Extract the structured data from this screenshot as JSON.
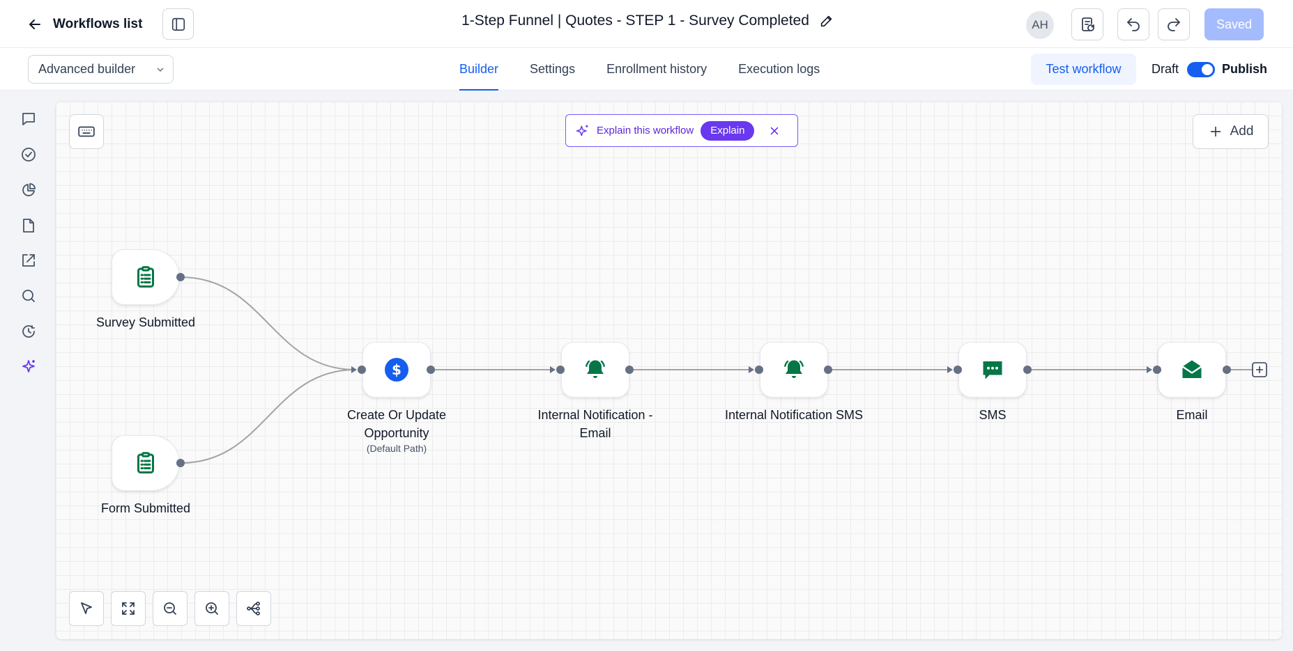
{
  "header": {
    "back_label": "Workflows list",
    "title": "1-Step Funnel | Quotes - STEP 1 - Survey Completed",
    "avatar_initials": "AH",
    "saved_label": "Saved"
  },
  "subheader": {
    "builder_mode": "Advanced builder",
    "tabs": [
      {
        "label": "Builder",
        "active": true
      },
      {
        "label": "Settings",
        "active": false
      },
      {
        "label": "Enrollment history",
        "active": false
      },
      {
        "label": "Execution logs",
        "active": false
      }
    ],
    "test_label": "Test workflow",
    "draft_label": "Draft",
    "publish_label": "Publish",
    "publish_toggle_on": true
  },
  "sidebar": {
    "items": [
      {
        "icon": "chat-icon"
      },
      {
        "icon": "check-circle-icon"
      },
      {
        "icon": "pie-chart-icon"
      },
      {
        "icon": "file-icon"
      },
      {
        "icon": "external-link-icon"
      },
      {
        "icon": "search-icon"
      },
      {
        "icon": "history-icon"
      },
      {
        "icon": "sparkle-icon",
        "active": true
      }
    ]
  },
  "canvas": {
    "explain": {
      "text": "Explain this workflow",
      "button": "Explain"
    },
    "add_label": "Add",
    "triggers": [
      {
        "label": "Survey Submitted",
        "icon": "clipboard-icon"
      },
      {
        "label": "Form Submitted",
        "icon": "clipboard-icon"
      }
    ],
    "actions": [
      {
        "label": "Create Or Update Opportunity",
        "sub": "(Default Path)",
        "icon": "dollar-icon"
      },
      {
        "label": "Internal Notification - Email",
        "sub": "",
        "icon": "bell-icon"
      },
      {
        "label": "Internal Notification SMS",
        "sub": "",
        "icon": "bell-icon"
      },
      {
        "label": "SMS",
        "sub": "",
        "icon": "message-icon"
      },
      {
        "label": "Email",
        "sub": "",
        "icon": "mail-icon"
      }
    ],
    "tools": [
      "pointer-icon",
      "fit-view-icon",
      "zoom-out-icon",
      "zoom-in-icon",
      "auto-layout-icon"
    ]
  },
  "colors": {
    "accent": "#155eef",
    "node_icon": "#067647",
    "explain_purple": "#6938ef"
  }
}
